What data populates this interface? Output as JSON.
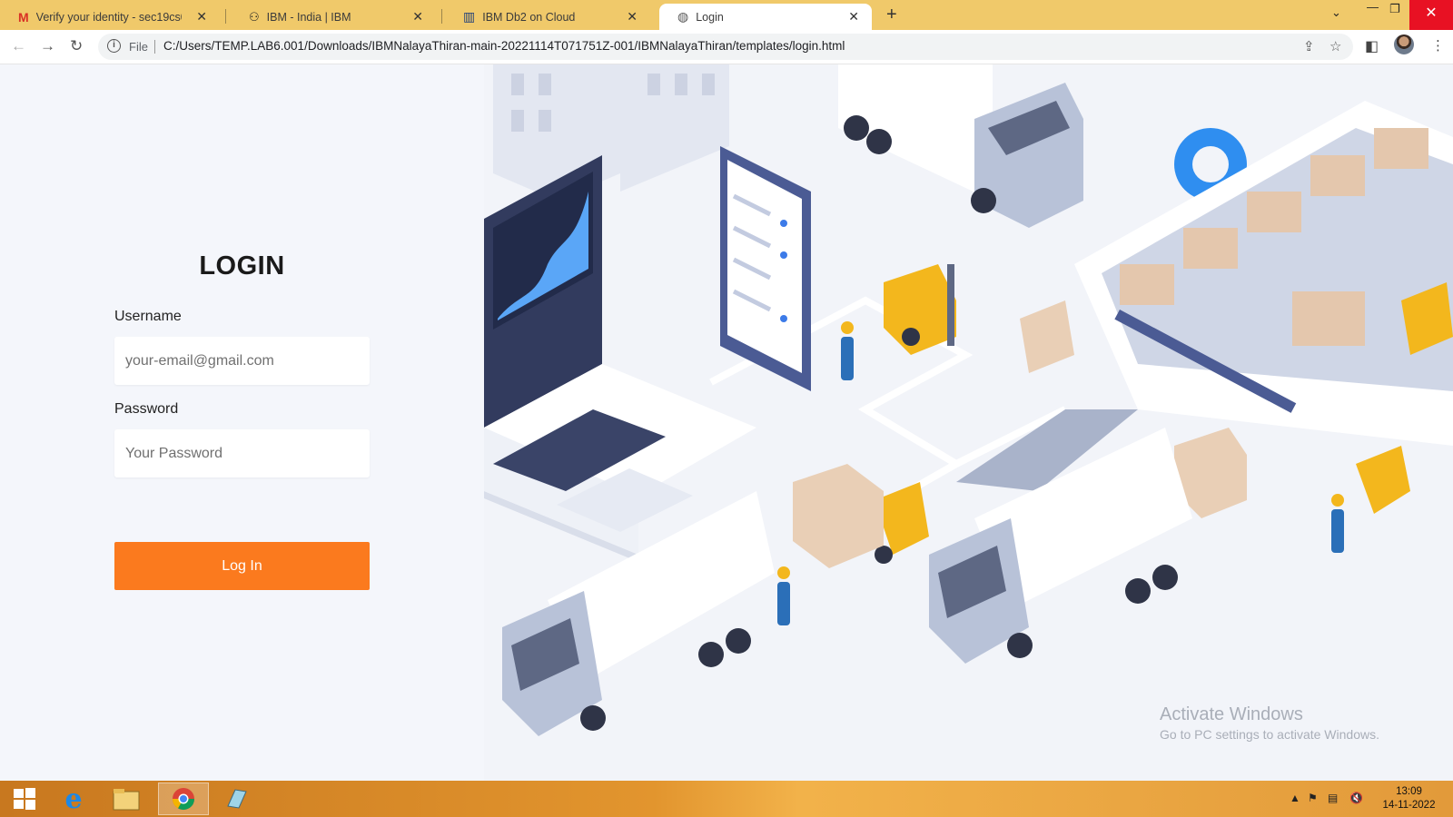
{
  "browser": {
    "tabs": [
      {
        "title": "Verify your identity - sec19cs080",
        "icon": "gmail-icon",
        "active": false
      },
      {
        "title": "IBM - India | IBM",
        "icon": "ibm-icon",
        "active": false
      },
      {
        "title": "IBM Db2 on Cloud",
        "icon": "db2-icon",
        "active": false
      },
      {
        "title": "Login",
        "icon": "globe-icon",
        "active": true
      }
    ],
    "new_tab_label": "+",
    "address": {
      "scheme_label": "File",
      "url": "C:/Users/TEMP.LAB6.001/Downloads/IBMNalayaThiran-main-20221114T071751Z-001/IBMNalayaThiran/templates/login.html"
    }
  },
  "login": {
    "title": "LOGIN",
    "username_label": "Username",
    "username_placeholder": "your-email@gmail.com",
    "password_label": "Password",
    "password_placeholder": "Your Password",
    "submit_label": "Log In"
  },
  "watermark": {
    "line1": "Activate Windows",
    "line2": "Go to PC settings to activate Windows."
  },
  "taskbar": {
    "apps": [
      "windows-start-icon",
      "internet-explorer-icon",
      "file-explorer-icon",
      "chrome-icon",
      "remote-desktop-icon"
    ],
    "time": "13:09",
    "date": "14-11-2022"
  },
  "colors": {
    "tabstrip": "#f0c96a",
    "login_button": "#fb7a1e",
    "page_background": "#f4f6fb"
  }
}
